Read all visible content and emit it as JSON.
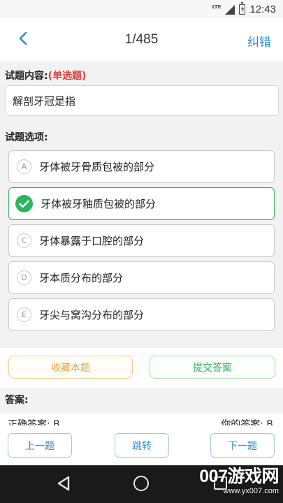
{
  "status_bar": {
    "network": "LTE",
    "time": "12:43"
  },
  "header": {
    "title": "1/485",
    "report_label": "纠错"
  },
  "question": {
    "label": "试题内容:",
    "type": "(单选题)",
    "text": "解剖牙冠是指"
  },
  "options": {
    "label": "试题选项:",
    "items": [
      {
        "letter": "A",
        "text": "牙体被牙骨质包被的部分",
        "selected": false
      },
      {
        "letter": "B",
        "text": "牙体被牙釉质包被的部分",
        "selected": true
      },
      {
        "letter": "C",
        "text": "牙体暴露于口腔的部分",
        "selected": false
      },
      {
        "letter": "D",
        "text": "牙本质分布的部分",
        "selected": false
      },
      {
        "letter": "E",
        "text": "牙尖与窝沟分布的部分",
        "selected": false
      }
    ]
  },
  "actions": {
    "favorite_label": "收藏本题",
    "submit_label": "提交答案"
  },
  "answer": {
    "label": "答案:",
    "correct": "正确答案: B",
    "yours": "你的答案: B"
  },
  "nav": {
    "prev_label": "上一题",
    "jump_label": "跳转",
    "next_label": "下一题"
  },
  "watermark": {
    "main": "007游戏网",
    "url": "www.yx007.com"
  },
  "colors": {
    "accent": "#2a8cdc",
    "success": "#2db55d",
    "danger": "#e53935",
    "warn": "#e5a43a"
  },
  "icons": {
    "back": "chevron-left-icon",
    "check": "check-circle-icon"
  }
}
